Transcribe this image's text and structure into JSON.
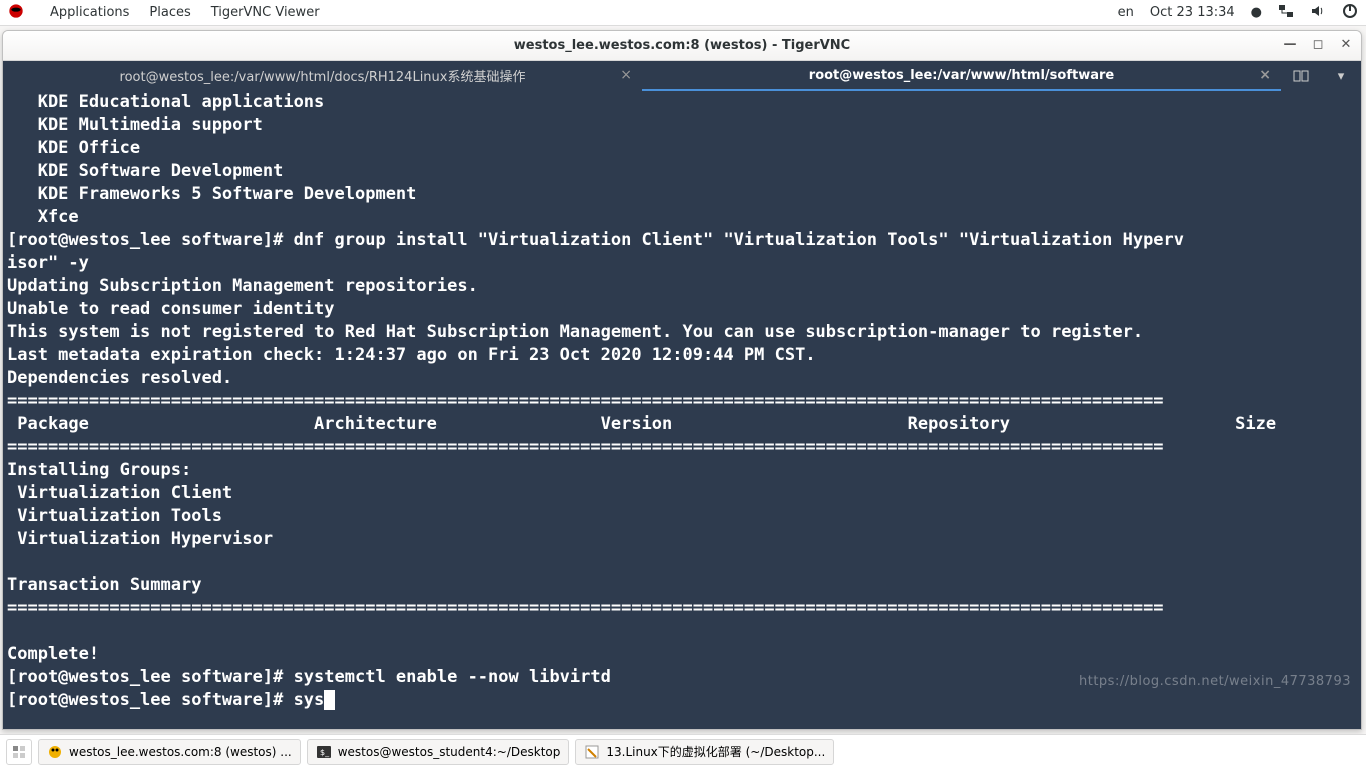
{
  "topbar": {
    "applications": "Applications",
    "places": "Places",
    "app": "TigerVNC Viewer",
    "lang": "en",
    "clock": "Oct 23  13:34"
  },
  "vnc": {
    "title": "westos_lee.westos.com:8 (westos) - TigerVNC"
  },
  "terminal": {
    "tabs": [
      {
        "label": "root@westos_lee:/var/www/html/docs/RH124Linux系统基础操作",
        "active": false
      },
      {
        "label": "root@westos_lee:/var/www/html/software",
        "active": true
      }
    ],
    "lines": [
      "   KDE Educational applications",
      "   KDE Multimedia support",
      "   KDE Office",
      "   KDE Software Development",
      "   KDE Frameworks 5 Software Development",
      "   Xfce",
      "[root@westos_lee software]# dnf group install \"Virtualization Client\" \"Virtualization Tools\" \"Virtualization Hyperv",
      "isor\" -y",
      "Updating Subscription Management repositories.",
      "Unable to read consumer identity",
      "This system is not registered to Red Hat Subscription Management. You can use subscription-manager to register.",
      "Last metadata expiration check: 1:24:37 ago on Fri 23 Oct 2020 12:09:44 PM CST.",
      "Dependencies resolved.",
      "=================================================================================================================",
      " Package                      Architecture                Version                       Repository                      Size",
      "=================================================================================================================",
      "Installing Groups:",
      " Virtualization Client",
      " Virtualization Tools",
      " Virtualization Hypervisor",
      "",
      "Transaction Summary",
      "=================================================================================================================",
      "",
      "Complete!",
      "[root@westos_lee software]# systemctl enable --now libvirtd",
      "[root@westos_lee software]# sys"
    ]
  },
  "taskbar": {
    "items": [
      "westos_lee.westos.com:8 (westos) ...",
      "westos@westos_student4:~/Desktop",
      "13.Linux下的虚拟化部署 (~/Desktop..."
    ]
  },
  "watermark": "https://blog.csdn.net/weixin_47738793"
}
